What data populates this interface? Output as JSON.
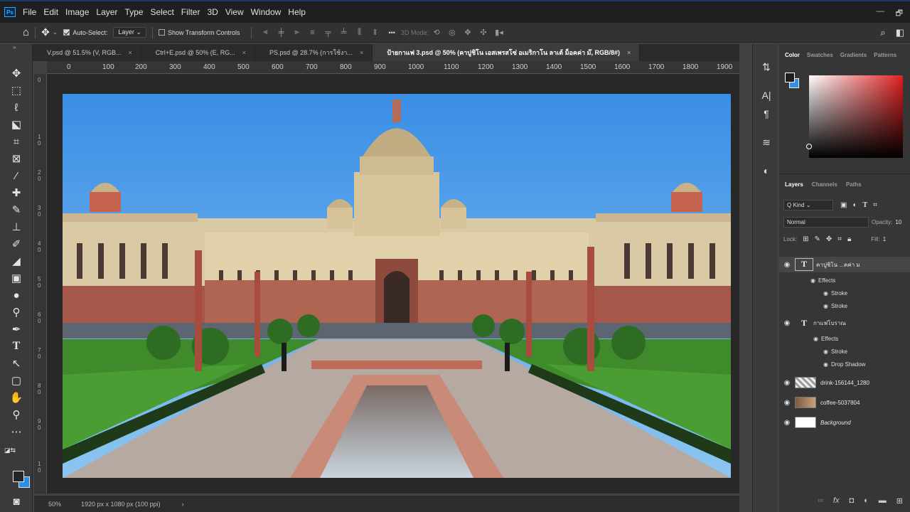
{
  "app": {
    "logo": "Ps"
  },
  "menu": [
    "File",
    "Edit",
    "Image",
    "Layer",
    "Type",
    "Select",
    "Filter",
    "3D",
    "View",
    "Window",
    "Help"
  ],
  "window_controls": {
    "minimize": "—",
    "restore": "🗗"
  },
  "options": {
    "auto_select_label": "Auto-Select:",
    "layer_select": "Layer",
    "transform_label": "Show Transform Controls",
    "mode_3d": "3D Mode:",
    "more": "•••"
  },
  "tabs": [
    {
      "label": "V.psd @ 51.5% (V, RGB..."
    },
    {
      "label": "Ctrl+E.psd @ 50% (E, RG..."
    },
    {
      "label": "PS.psd @ 28.7% (การใช้งา..."
    },
    {
      "label": "ป้ายกาแฟ 3.psd @ 50% (คาปูชิโน เอสเพรสโซ่ อเมริกาโน ลาเต้ ม็อคค่า ม๊, RGB/8#)",
      "active": true
    }
  ],
  "ruler_top": [
    "0",
    "100",
    "200",
    "300",
    "400",
    "500",
    "600",
    "700",
    "800",
    "900",
    "1000",
    "1100",
    "1200",
    "1300",
    "1400",
    "1500",
    "1600",
    "1700",
    "1800",
    "1900"
  ],
  "ruler_left": [
    "0",
    "1\n0",
    "2\n0",
    "3\n0",
    "4\n0",
    "5\n0",
    "6\n0",
    "7\n0",
    "8\n0",
    "9\n0",
    "1\n0"
  ],
  "status": {
    "zoom": "50%",
    "doc": "1920 px x 1080 px (100 ppi)",
    "chevron": "›"
  },
  "color_panel": {
    "tabs": [
      "Color",
      "Swatches",
      "Gradients",
      "Patterns"
    ]
  },
  "layers_panel": {
    "tabs": [
      "Layers",
      "Channels",
      "Paths"
    ],
    "kind": "Q Kind",
    "blend_mode": "Normal",
    "opacity_label": "Opacity:",
    "opacity_value": "10",
    "lock_label": "Lock:",
    "fill_label": "Fill:",
    "fill_value": "1",
    "layers": [
      {
        "name": "คาปูชิโน ...คค่า ม",
        "type": "text",
        "selected": true,
        "effects_label": "Effects",
        "effects": [
          "Stroke",
          "Stroke"
        ]
      },
      {
        "name": "กาแฟโบราณ",
        "type": "text",
        "effects_label": "Effects",
        "effects": [
          "Stroke",
          "Drop Shadow"
        ]
      },
      {
        "name": "drink-156144_1280",
        "type": "image"
      },
      {
        "name": "coffee-5037804",
        "type": "image"
      },
      {
        "name": "Background",
        "type": "background"
      }
    ]
  },
  "colors": {
    "accent": "#31a8ff",
    "bg_swatch": "#2f8fe9",
    "sky": "#3a8ee6"
  }
}
